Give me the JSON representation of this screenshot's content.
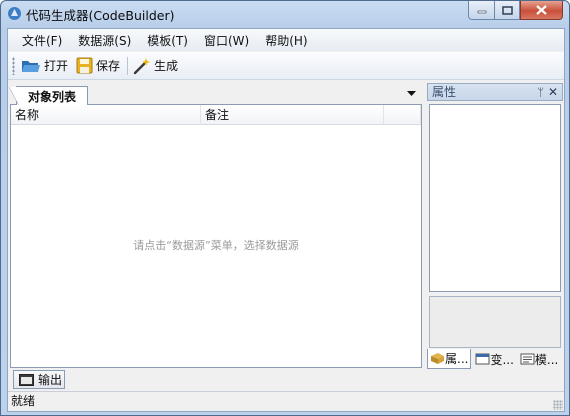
{
  "window": {
    "title": "代码生成器(CodeBuilder)"
  },
  "menu": [
    "文件(F)",
    "数据源(S)",
    "模板(T)",
    "窗口(W)",
    "帮助(H)"
  ],
  "toolbar": {
    "open": "打开",
    "save": "保存",
    "generate": "生成"
  },
  "doc": {
    "tab": "对象列表",
    "columns": [
      "名称",
      "备注"
    ],
    "empty_message": "请点击“数据源”菜单，选择数据源"
  },
  "props": {
    "title": "属性",
    "pin_glyph": "ᛘ",
    "close_glyph": "✕",
    "tabs": [
      "属...",
      "变...",
      "模..."
    ]
  },
  "output_tab": "输出",
  "status": "就绪",
  "colors": {
    "title_bar": "#bcd2ec",
    "close_button": "#c9503a"
  },
  "icons": [
    "app-icon",
    "open-folder-icon",
    "save-disk-icon",
    "magic-wand-icon",
    "dropdown-arrow-icon",
    "pin-icon",
    "close-icon",
    "property-tab-icon",
    "variable-tab-icon",
    "template-tab-icon",
    "output-console-icon"
  ]
}
